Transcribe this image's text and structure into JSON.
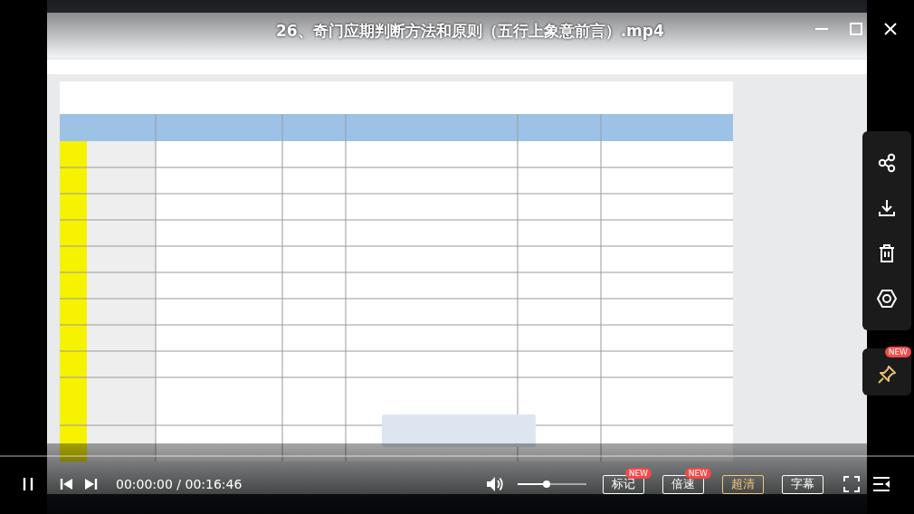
{
  "window": {
    "title": "26、奇门应期判断方法和原则（五行上象意前言）.mp4"
  },
  "side_panel": {
    "actions": [
      {
        "kind": "share"
      },
      {
        "kind": "download"
      },
      {
        "kind": "delete"
      },
      {
        "kind": "settings"
      }
    ],
    "pin": {
      "badge": "NEW"
    }
  },
  "controls": {
    "progress": {
      "level": 0
    },
    "time": "00:00:00 / 00:16:46",
    "volume": {
      "level": 0.42
    },
    "buttons": [
      {
        "label": "标记",
        "badge": "NEW",
        "selected": false
      },
      {
        "label": "倍速",
        "badge": "NEW",
        "selected": false
      },
      {
        "label": "超清",
        "selected": true
      },
      {
        "label": "字幕",
        "selected": false
      }
    ]
  }
}
